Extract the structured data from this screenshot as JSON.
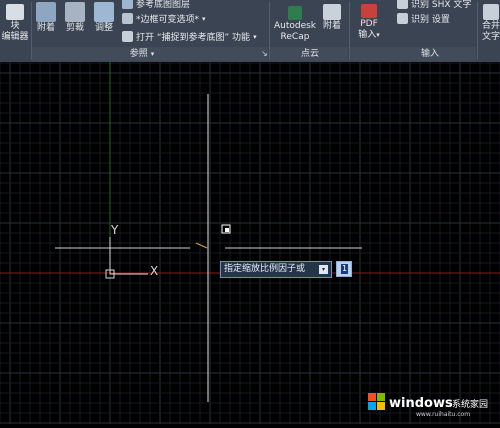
{
  "ribbon": {
    "block_editor": {
      "line1": "块",
      "line2": "编辑器"
    },
    "reference": {
      "attach": "附着",
      "clip": "剪裁",
      "adjust": "调整",
      "underlay_layers": "参考底图图层",
      "frames": "*边框可变选项*",
      "snap": "打开 “捕捉到参考底图” 功能",
      "title": "参照"
    },
    "pointcloud": {
      "recap_line1": "Autodesk",
      "recap_line2": "ReCap",
      "attach": "附着",
      "title": "点云"
    },
    "import": {
      "pdf_line1": "PDF",
      "pdf_line2": "输入",
      "shx": "识别 SHX 文字",
      "settings": "识别 设置",
      "title": "输入"
    },
    "merge_text": {
      "line1": "合并",
      "line2": "文字"
    }
  },
  "canvas": {
    "ucs_y_label": "Y",
    "ucs_x_label": "X",
    "prompt": "指定缩放比例因子或",
    "prompt_arrow": "▾",
    "input_value": "1"
  },
  "watermark": {
    "brand": "windows",
    "suffix": "系统家园",
    "url": "www.ruihaitu.com"
  },
  "colors": {
    "ribbon_bg": "#3b4453",
    "canvas_bg": "#000000",
    "grid_minor": "#16191f",
    "grid_major": "#2a2f38",
    "crosshair": "#e6e6e6",
    "axis_x": "#8a1d1d",
    "axis_y": "#1f6a2a"
  }
}
